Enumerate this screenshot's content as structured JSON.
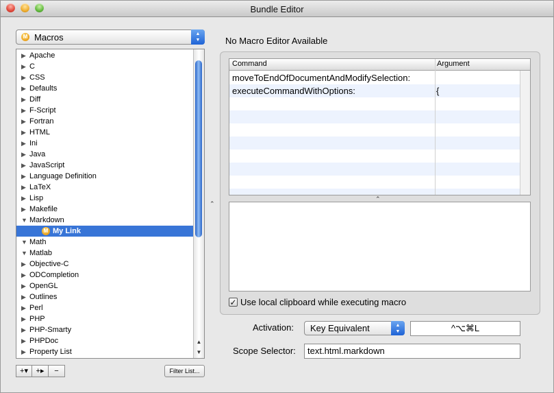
{
  "window": {
    "title": "Bundle Editor"
  },
  "bundle_popup": {
    "icon": "macro-badge-icon",
    "badge_letter": "M",
    "value": "Macros"
  },
  "tree": {
    "items": [
      {
        "label": "Apache",
        "state": "collapsed"
      },
      {
        "label": "C",
        "state": "collapsed"
      },
      {
        "label": "CSS",
        "state": "collapsed"
      },
      {
        "label": "Defaults",
        "state": "collapsed"
      },
      {
        "label": "Diff",
        "state": "collapsed"
      },
      {
        "label": "F-Script",
        "state": "collapsed"
      },
      {
        "label": "Fortran",
        "state": "collapsed"
      },
      {
        "label": "HTML",
        "state": "collapsed"
      },
      {
        "label": "Ini",
        "state": "collapsed"
      },
      {
        "label": "Java",
        "state": "collapsed"
      },
      {
        "label": "JavaScript",
        "state": "collapsed"
      },
      {
        "label": "Language Definition",
        "state": "collapsed"
      },
      {
        "label": "LaTeX",
        "state": "collapsed"
      },
      {
        "label": "Lisp",
        "state": "collapsed"
      },
      {
        "label": "Makefile",
        "state": "collapsed"
      },
      {
        "label": "Markdown",
        "state": "expanded"
      },
      {
        "label": "My Link",
        "state": "child-selected"
      },
      {
        "label": "Math",
        "state": "expanded"
      },
      {
        "label": "Matlab",
        "state": "expanded"
      },
      {
        "label": "Objective-C",
        "state": "collapsed"
      },
      {
        "label": "ODCompletion",
        "state": "collapsed"
      },
      {
        "label": "OpenGL",
        "state": "collapsed"
      },
      {
        "label": "Outlines",
        "state": "collapsed"
      },
      {
        "label": "Perl",
        "state": "collapsed"
      },
      {
        "label": "PHP",
        "state": "collapsed"
      },
      {
        "label": "PHP-Smarty",
        "state": "collapsed"
      },
      {
        "label": "PHPDoc",
        "state": "collapsed"
      },
      {
        "label": "Property List",
        "state": "collapsed"
      }
    ]
  },
  "bottom_buttons": {
    "add": "+▾",
    "add_child": "+▸",
    "remove": "−",
    "filter": "Filter List..."
  },
  "editor": {
    "title": "No Macro Editor Available",
    "table": {
      "headers": [
        "Command",
        "Argument"
      ],
      "rows": [
        {
          "command": "moveToEndOfDocumentAndModifySelection:",
          "argument": ""
        },
        {
          "command": "executeCommandWithOptions:",
          "argument": "{"
        }
      ]
    },
    "checkbox": {
      "label": "Use local clipboard while executing macro",
      "checked": true
    }
  },
  "activation": {
    "label": "Activation:",
    "value": "Key Equivalent",
    "key": "^⌥⌘L"
  },
  "scope": {
    "label": "Scope Selector:",
    "value": "text.html.markdown"
  },
  "colors": {
    "selection": "#3875d7",
    "alt_row": "#edf3fe"
  }
}
